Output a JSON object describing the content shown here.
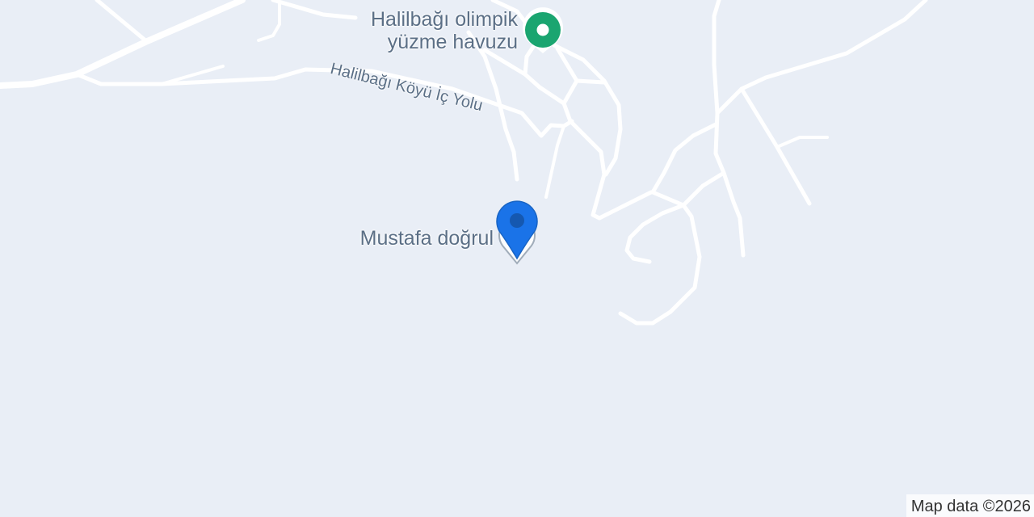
{
  "map": {
    "poi_pool": {
      "line1": "Halilbağı olimpik",
      "line2": "yüzme havuzu",
      "icon": "green-place-pin-icon",
      "color": "#1aa570"
    },
    "road_label": "Halilbağı Köyü İç Yolu",
    "selected_place": {
      "label": "Mustafa doğrul",
      "icon": "blue-location-pin-icon",
      "color": "#1a73e8"
    },
    "attribution": "Map data ©2026"
  }
}
